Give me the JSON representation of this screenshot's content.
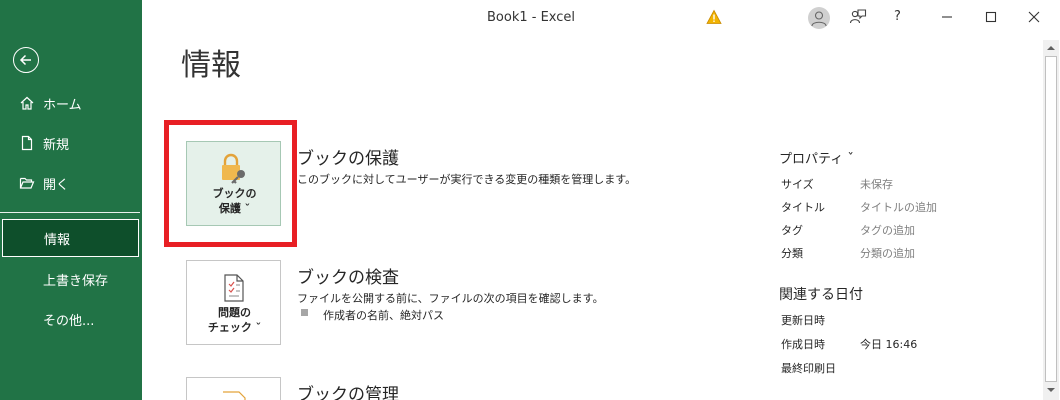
{
  "window": {
    "title": "Book1  -  Excel",
    "help_label": "?"
  },
  "nav": {
    "back_label": "",
    "items": [
      {
        "label": "ホーム",
        "icon": "home-icon"
      },
      {
        "label": "新規",
        "icon": "new-file-icon"
      },
      {
        "label": "開く",
        "icon": "folder-open-icon"
      },
      {
        "label": "情報",
        "selected": true
      },
      {
        "label": "上書き保存"
      },
      {
        "label": "その他..."
      }
    ]
  },
  "main": {
    "title": "情報",
    "sections": [
      {
        "tile_label_line1": "ブックの",
        "tile_label_line2": "保護 ˇ",
        "icon": "lock-key-icon",
        "heading": "ブックの保護",
        "description": "このブックに対してユーザーが実行できる変更の種類を管理します。"
      },
      {
        "tile_label_line1": "問題の",
        "tile_label_line2": "チェック ˇ",
        "icon": "inspect-document-icon",
        "heading": "ブックの検査",
        "description": "ファイルを公開する前に、ファイルの次の項目を確認します。",
        "bullet": "作成者の名前、絶対パス"
      },
      {
        "heading": "ブックの管理"
      }
    ]
  },
  "properties": {
    "heading": "プロパティ ˇ",
    "rows": [
      {
        "label": "サイズ",
        "value": "未保存"
      },
      {
        "label": "タイトル",
        "value": "タイトルの追加"
      },
      {
        "label": "タグ",
        "value": "タグの追加"
      },
      {
        "label": "分類",
        "value": "分類の追加"
      }
    ],
    "dates_heading": "関連する日付",
    "dates": [
      {
        "label": "更新日時",
        "value": ""
      },
      {
        "label": "作成日時",
        "value": "今日 16:46"
      },
      {
        "label": "最終印刷日",
        "value": ""
      }
    ]
  },
  "colors": {
    "excel_green": "#217346",
    "nav_selected": "#0e4f2b",
    "highlight_red": "#e81f24"
  }
}
